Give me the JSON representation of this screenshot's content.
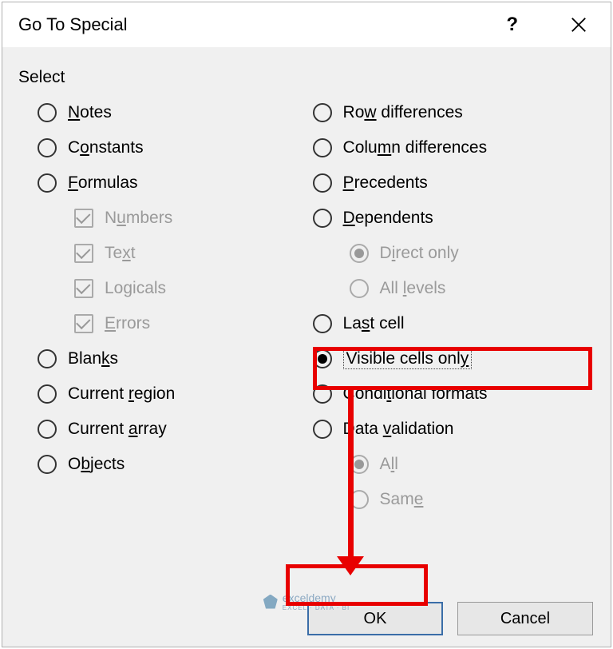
{
  "titlebar": {
    "title": "Go To Special",
    "help": "?",
    "close": "×"
  },
  "group_label": "Select",
  "left": {
    "notes": {
      "pre": "",
      "u": "N",
      "post": "otes"
    },
    "constants": {
      "pre": "C",
      "u": "o",
      "post": "nstants"
    },
    "formulas": {
      "pre": "",
      "u": "F",
      "post": "ormulas"
    },
    "numbers": {
      "pre": "N",
      "u": "u",
      "post": "mbers"
    },
    "text": {
      "pre": "Te",
      "u": "x",
      "post": "t"
    },
    "logicals": {
      "pre": "Lo",
      "u": "g",
      "post": "icals"
    },
    "errors": {
      "pre": "",
      "u": "E",
      "post": "rrors"
    },
    "blanks": {
      "pre": "Blan",
      "u": "k",
      "post": "s"
    },
    "current_region": {
      "pre": "Current ",
      "u": "r",
      "post": "egion"
    },
    "current_array": {
      "pre": "Current ",
      "u": "a",
      "post": "rray"
    },
    "objects": {
      "pre": "O",
      "u": "b",
      "post": "jects"
    }
  },
  "right": {
    "row_diff": {
      "pre": "Ro",
      "u": "w",
      "post": " differences"
    },
    "col_diff": {
      "pre": "Colu",
      "u": "m",
      "post": "n differences"
    },
    "precedents": {
      "pre": "",
      "u": "P",
      "post": "recedents"
    },
    "dependents": {
      "pre": "",
      "u": "D",
      "post": "ependents"
    },
    "direct_only": {
      "pre": "D",
      "u": "i",
      "post": "rect only"
    },
    "all_levels": {
      "pre": "All ",
      "u": "l",
      "post": "evels"
    },
    "last_cell": {
      "pre": "La",
      "u": "s",
      "post": "t cell"
    },
    "visible": {
      "pre": "Visible cells onl",
      "u": "y",
      "post": ""
    },
    "conditional": {
      "pre": "Condi",
      "u": "t",
      "post": "ional formats"
    },
    "data_validation": {
      "pre": "Data ",
      "u": "v",
      "post": "alidation"
    },
    "all": {
      "pre": "A",
      "u": "l",
      "post": "l"
    },
    "same": {
      "pre": "Sam",
      "u": "e",
      "post": ""
    }
  },
  "buttons": {
    "ok": "OK",
    "cancel": "Cancel"
  },
  "watermark": {
    "name": "exceldemy",
    "sub": "EXCEL · DATA · BI"
  }
}
